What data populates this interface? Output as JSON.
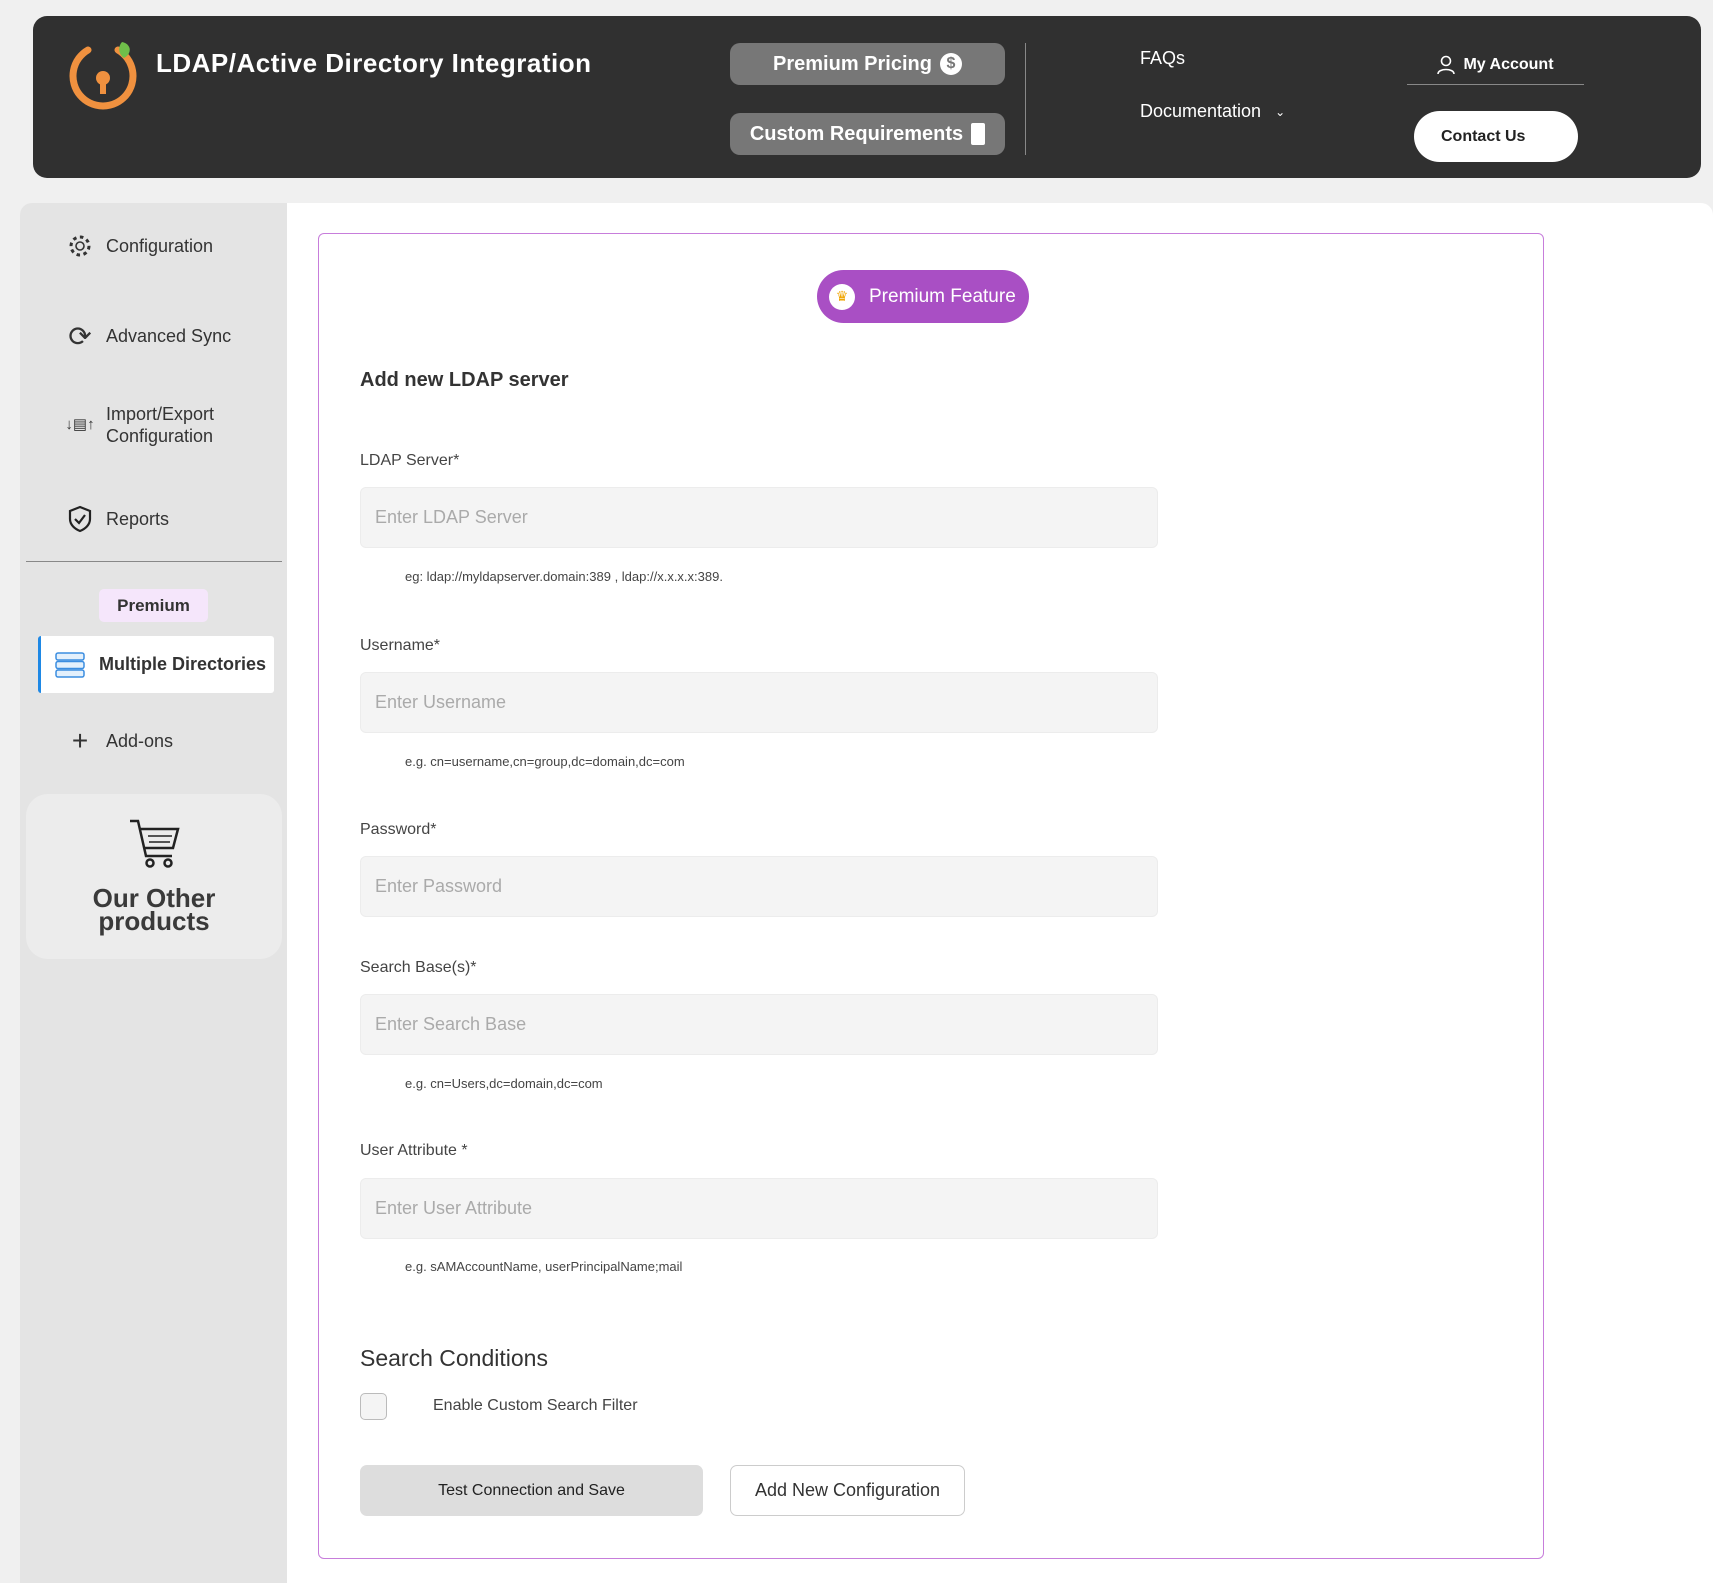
{
  "header": {
    "title": "LDAP/Active Directory Integration",
    "premium_pricing": "Premium Pricing",
    "custom_requirements": "Custom Requirements",
    "faqs": "FAQs",
    "documentation": "Documentation",
    "my_account": "My Account",
    "contact_us": "Contact Us"
  },
  "sidebar": {
    "items": [
      {
        "label": "Configuration",
        "icon": "gear-icon"
      },
      {
        "label": "Advanced Sync",
        "icon": "sync-icon"
      },
      {
        "label": "Import/Export",
        "label2": "Configuration",
        "icon": "import-export-icon"
      },
      {
        "label": "Reports",
        "icon": "shield-check-icon"
      }
    ],
    "premium_badge": "Premium",
    "multiple_directories": "Multiple Directories",
    "addons": "Add-ons",
    "other_products_1": "Our Other",
    "other_products_2": "products"
  },
  "colors": {
    "accent": "#a94fc4",
    "header_bg": "#303030",
    "active_border": "#1e88e5"
  },
  "form": {
    "premium_feature": "Premium Feature",
    "title": "Add new LDAP server",
    "fields": [
      {
        "label": "LDAP Server*",
        "placeholder": "Enter LDAP Server",
        "hint": "eg: ldap://myldapserver.domain:389 , ldap://x.x.x.x:389."
      },
      {
        "label": "Username*",
        "placeholder": "Enter Username",
        "hint": "e.g. cn=username,cn=group,dc=domain,dc=com"
      },
      {
        "label": "Password*",
        "placeholder": "Enter Password",
        "hint": ""
      },
      {
        "label": "Search Base(s)*",
        "placeholder": "Enter Search Base",
        "hint": "e.g. cn=Users,dc=domain,dc=com"
      },
      {
        "label": "User Attribute *",
        "placeholder": "Enter User Attribute",
        "hint": "e.g. sAMAccountName, userPrincipalName;mail"
      }
    ],
    "search_conditions": "Search Conditions",
    "enable_custom_filter": "Enable Custom Search Filter",
    "enable_custom_filter_checked": false,
    "test_save": "Test Connection and Save",
    "add_new": "Add New Configuration"
  }
}
